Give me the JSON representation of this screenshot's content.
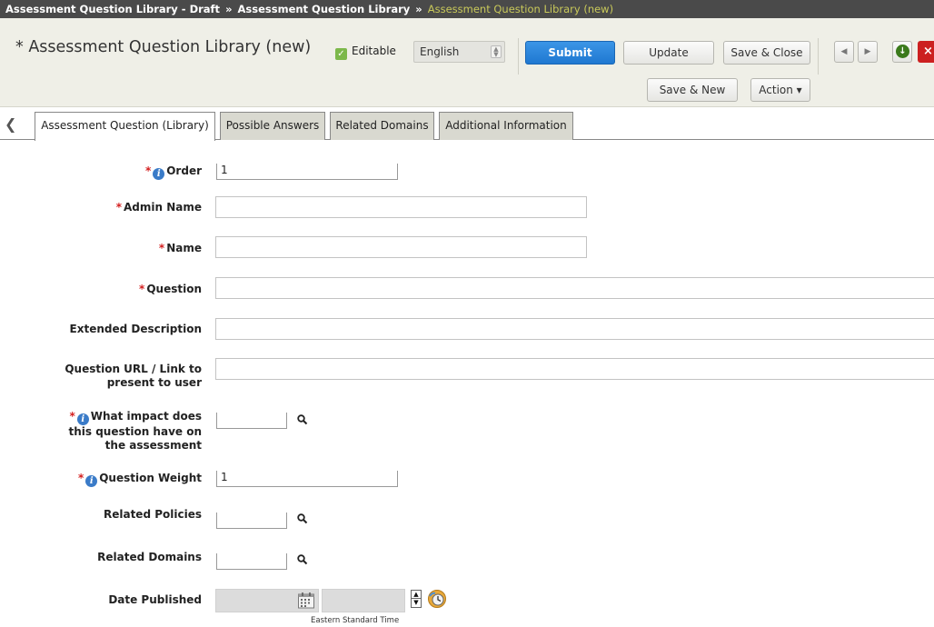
{
  "breadcrumb": {
    "items": [
      "Assessment Question Library - Draft",
      "Assessment Question Library"
    ],
    "separator": "»",
    "current": "Assessment Question Library (new)"
  },
  "header": {
    "title": "* Assessment Question Library (new)",
    "editable_label": "Editable",
    "language": "English",
    "buttons": {
      "submit": "Submit",
      "update": "Update",
      "save_close": "Save & Close",
      "save_new": "Save & New",
      "action": "Action ▾",
      "prev": "◀",
      "next": "▶",
      "close": "×",
      "download": "↓"
    }
  },
  "tabs": {
    "scroll_left": "❮",
    "items": [
      {
        "label": "Assessment Question (Library)",
        "active": true
      },
      {
        "label": "Possible Answers",
        "active": false
      },
      {
        "label": "Related Domains",
        "active": false
      },
      {
        "label": "Additional Information",
        "active": false
      }
    ]
  },
  "form": {
    "required_marker": "*",
    "info_glyph": "i",
    "fields": {
      "order": {
        "label": "Order",
        "value": "1"
      },
      "admin_name": {
        "label": "Admin Name",
        "value": ""
      },
      "name": {
        "label": "Name",
        "value": ""
      },
      "question": {
        "label": "Question",
        "value": ""
      },
      "extended_description": {
        "label": "Extended Description",
        "value": ""
      },
      "question_url": {
        "label_line1": "Question URL / Link to",
        "label_line2": "present to user",
        "value": ""
      },
      "impact": {
        "label_line1": "What impact does",
        "label_line2": "this question have on",
        "label_line3": "the assessment",
        "value": ""
      },
      "question_weight": {
        "label": "Question Weight",
        "value": "1"
      },
      "related_policies": {
        "label": "Related Policies",
        "value": ""
      },
      "related_domains": {
        "label": "Related Domains",
        "value": ""
      },
      "date_published": {
        "label": "Date Published",
        "date": "",
        "time": "",
        "timezone": "Eastern Standard Time"
      }
    }
  },
  "colors": {
    "breadcrumb_bg": "#4a4a4a",
    "breadcrumb_current": "#c9c95a",
    "header_bg": "#efefe7",
    "primary": "#1f78d1",
    "required": "#d42020",
    "info": "#3a7bc8",
    "tab_inactive": "#d9d9d0",
    "close_red": "#cc2020"
  }
}
